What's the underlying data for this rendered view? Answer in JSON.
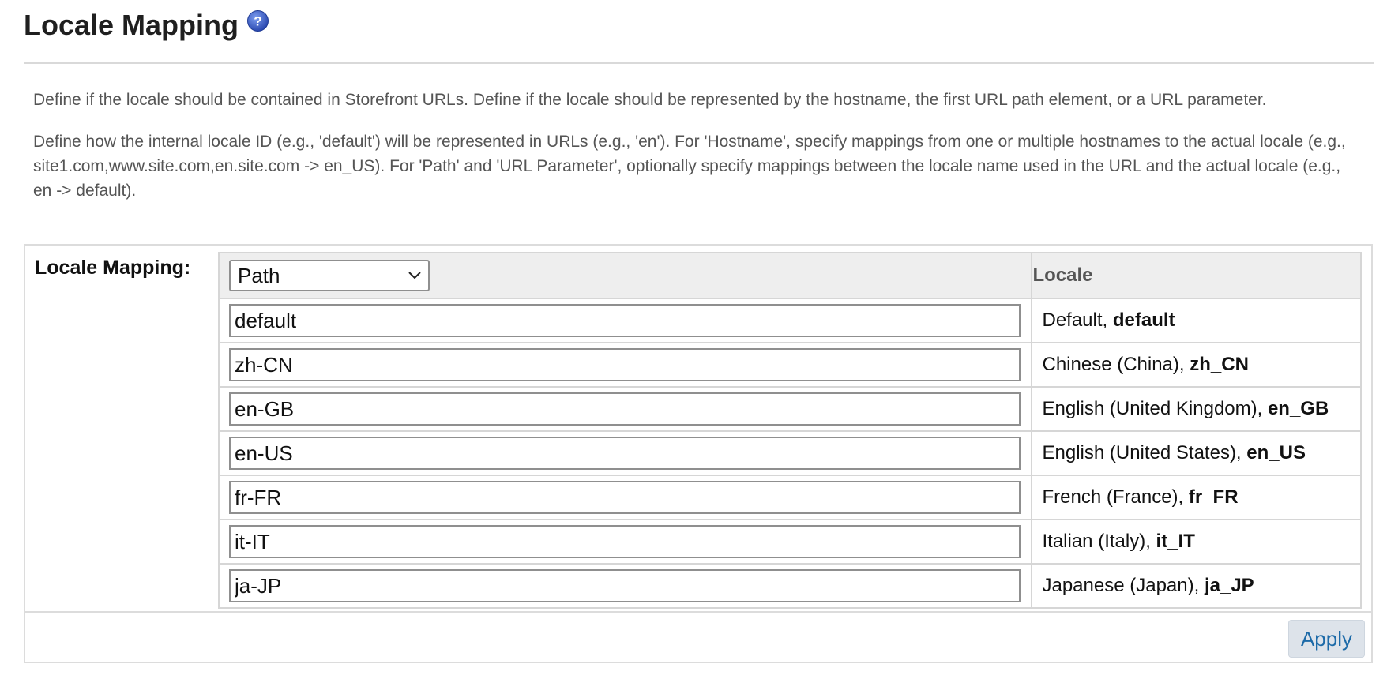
{
  "header": {
    "title": "Locale Mapping",
    "help_icon": "question-circle-icon"
  },
  "description": {
    "paragraph_1": "Define if the locale should be contained in Storefront URLs. Define if the locale should be represented by the hostname, the first URL path element, or a URL parameter.",
    "paragraph_2": "Define how the internal locale ID (e.g., 'default') will be represented in URLs (e.g., 'en'). For 'Hostname', specify mappings from one or multiple hostnames to the actual locale (e.g., site1.com,www.site.com,en.site.com -> en_US). For 'Path' and 'URL Parameter', optionally specify mappings between the locale name used in the URL and the actual locale (e.g., en -> default)."
  },
  "form": {
    "label": "Locale Mapping:",
    "mode_select": {
      "selected": "Path",
      "icon": "chevron-down-icon"
    },
    "column_locale": "Locale",
    "rows": [
      {
        "value": "default",
        "locale_name": "Default, ",
        "locale_code": "default"
      },
      {
        "value": "zh-CN",
        "locale_name": "Chinese (China), ",
        "locale_code": "zh_CN"
      },
      {
        "value": "en-GB",
        "locale_name": "English (United Kingdom), ",
        "locale_code": "en_GB"
      },
      {
        "value": "en-US",
        "locale_name": "English (United States), ",
        "locale_code": "en_US"
      },
      {
        "value": "fr-FR",
        "locale_name": "French (France), ",
        "locale_code": "fr_FR"
      },
      {
        "value": "it-IT",
        "locale_name": "Italian (Italy), ",
        "locale_code": "it_IT"
      },
      {
        "value": "ja-JP",
        "locale_name": "Japanese (Japan), ",
        "locale_code": "ja_JP"
      }
    ],
    "apply_label": "Apply"
  },
  "colors": {
    "help_icon": "#3b5fc0",
    "apply_text": "#1c6aa8",
    "apply_bg": "#dde3ea",
    "header_bg": "#eeeeee"
  }
}
